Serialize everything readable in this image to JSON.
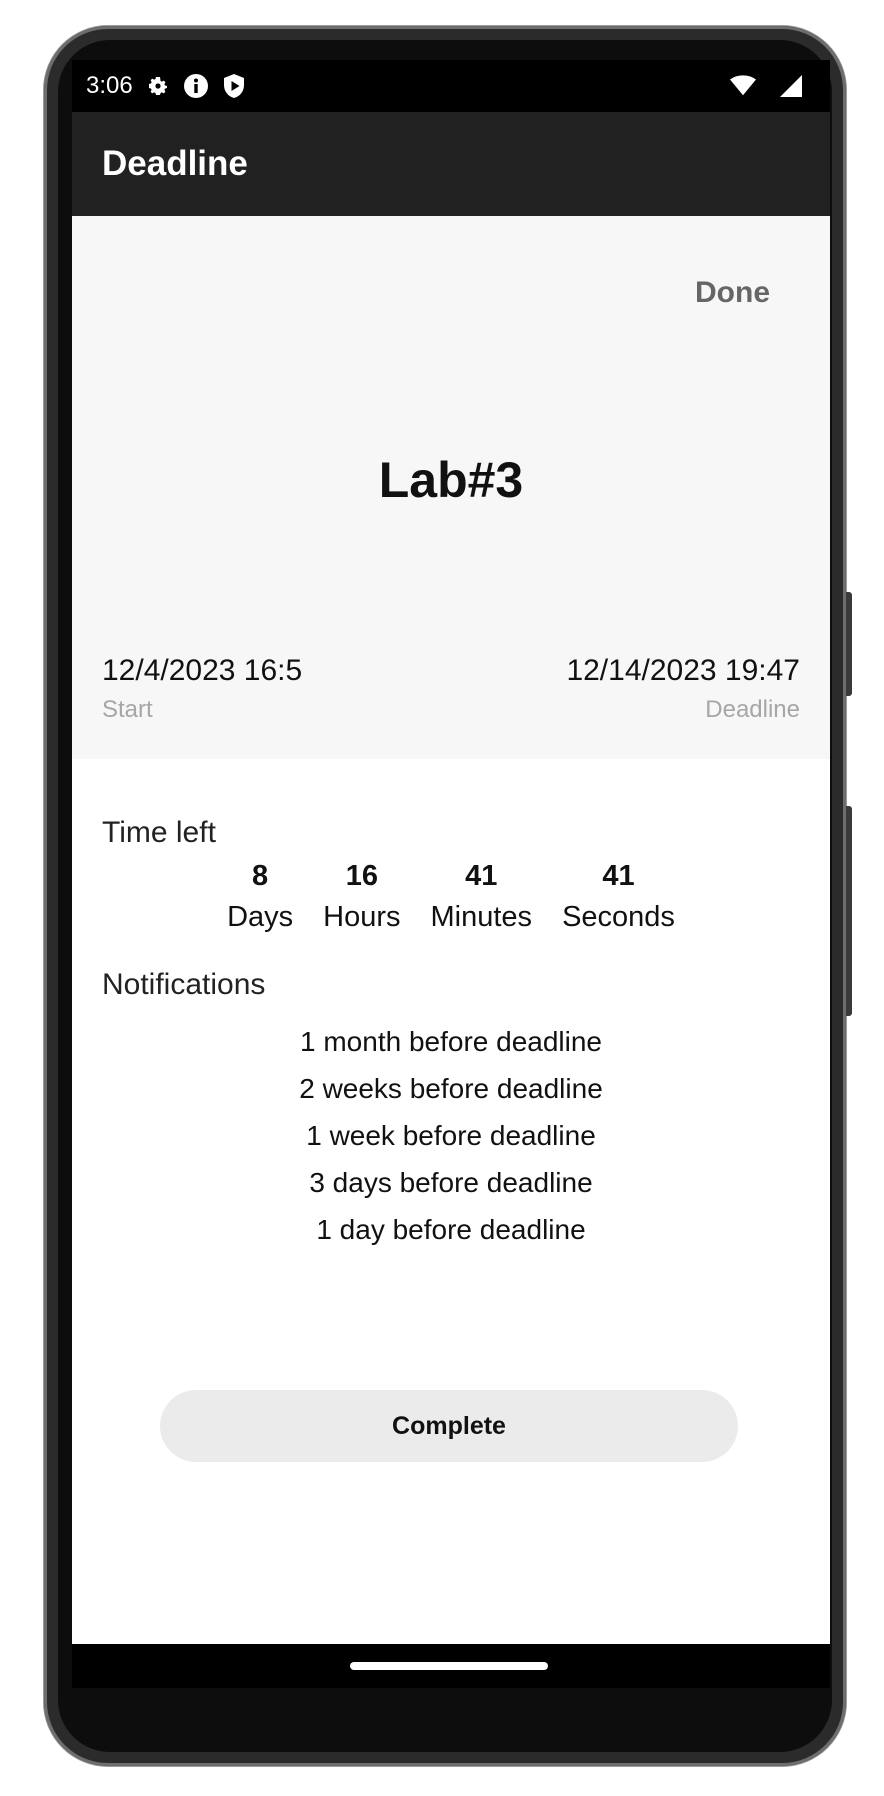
{
  "status_bar": {
    "time": "3:06",
    "icons_left": [
      "settings-icon",
      "info-icon",
      "shield-play-icon"
    ],
    "icons_right": [
      "wifi-icon",
      "cell-signal-icon"
    ]
  },
  "app_bar": {
    "title": "Deadline"
  },
  "header": {
    "done_label": "Done",
    "task_title": "Lab#3",
    "start_value": "12/4/2023 16:5",
    "start_label": "Start",
    "deadline_value": "12/14/2023 19:47",
    "deadline_label": "Deadline"
  },
  "time_left": {
    "label": "Time left",
    "units": [
      {
        "value": "8",
        "label": "Days"
      },
      {
        "value": "16",
        "label": "Hours"
      },
      {
        "value": "41",
        "label": "Minutes"
      },
      {
        "value": "41",
        "label": "Seconds"
      }
    ]
  },
  "notifications": {
    "label": "Notifications",
    "items": [
      "1 month before deadline",
      "2 weeks before deadline",
      "1 week before deadline",
      "3 days before deadline",
      "1 day before deadline"
    ]
  },
  "actions": {
    "complete_label": "Complete"
  }
}
